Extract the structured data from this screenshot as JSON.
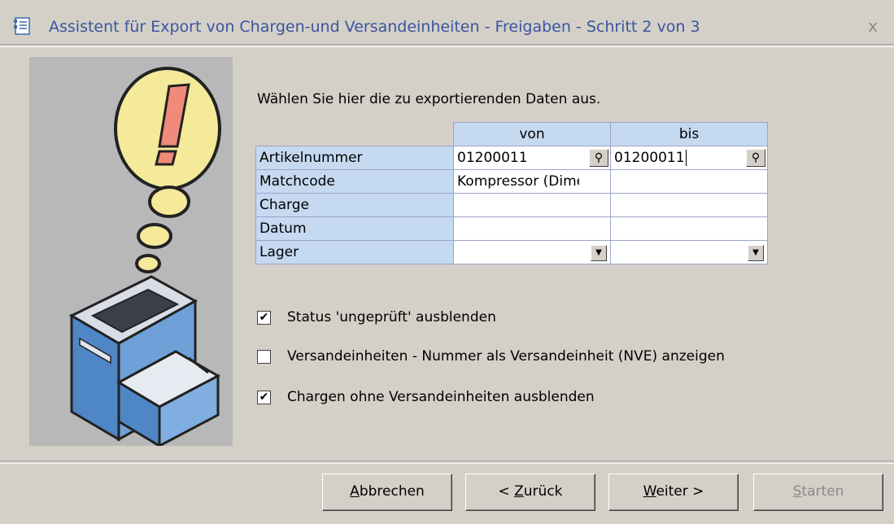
{
  "window": {
    "title": "Assistent für Export von Chargen-und Versandeinheiten - Freigaben - Schritt 2 von 3",
    "close_glyph": "x"
  },
  "content": {
    "intro": "Wählen Sie hier die zu exportierenden Daten aus.",
    "columns": {
      "von": "von",
      "bis": "bis"
    },
    "rows": [
      {
        "label": "Artikelnummer",
        "von": "01200011",
        "bis": "01200011",
        "control": "lookup"
      },
      {
        "label": "Matchcode",
        "von": "Kompressor (Dimens",
        "bis": "",
        "control": "none"
      },
      {
        "label": "Charge",
        "von": "",
        "bis": "",
        "control": "none"
      },
      {
        "label": "Datum",
        "von": "",
        "bis": "",
        "control": "none"
      },
      {
        "label": "Lager",
        "von": "",
        "bis": "",
        "control": "dropdown"
      }
    ],
    "checkboxes": [
      {
        "label": "Status 'ungeprüft' ausblenden",
        "checked": true
      },
      {
        "label": "Versandeinheiten - Nummer als Versandeinheit (NVE) anzeigen",
        "checked": false
      },
      {
        "label": "Chargen ohne Versandeinheiten ausblenden",
        "checked": true
      }
    ]
  },
  "buttons": {
    "cancel": {
      "mnemonic": "A",
      "rest": "bbrechen",
      "enabled": true
    },
    "back": {
      "prefix": "< ",
      "mnemonic": "Z",
      "rest": "urück",
      "enabled": true
    },
    "next": {
      "mnemonic": "W",
      "rest": "eiter >",
      "enabled": true
    },
    "start": {
      "mnemonic": "S",
      "rest": "tarten",
      "enabled": false
    }
  },
  "icons": {
    "title": "wizard-form-icon",
    "lookup": "magnifier-icon",
    "dropdown": "chevron-down-icon",
    "illustration": "printer-exclamation-illustration"
  },
  "colors": {
    "dialog_bg": "#d4d0c8",
    "title_text": "#3a55a0",
    "grid_header": "#c5d9f1",
    "illustration_bg": "#b8b8b8"
  }
}
